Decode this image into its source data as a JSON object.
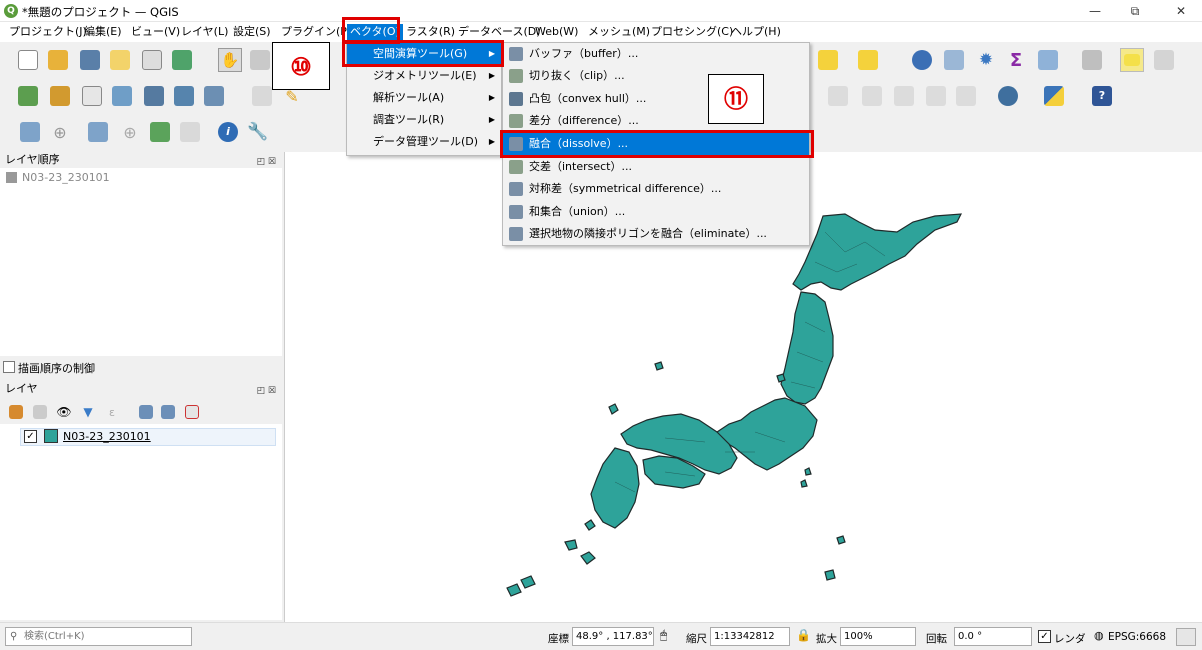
{
  "window": {
    "title": "*無題のプロジェクト — QGIS",
    "minimize": "—",
    "restore": "⧉",
    "close": "✕"
  },
  "menubar": [
    {
      "label": "プロジェクト(J)"
    },
    {
      "label": "編集(E)"
    },
    {
      "label": "ビュー(V)"
    },
    {
      "label": "レイヤ(L)"
    },
    {
      "label": "設定(S)"
    },
    {
      "label": "プラグイン(P)"
    },
    {
      "label": "ベクタ(O)"
    },
    {
      "label": "ラスタ(R)"
    },
    {
      "label": "データベース(D)"
    },
    {
      "label": "Web(W)"
    },
    {
      "label": "メッシュ(M)"
    },
    {
      "label": "プロセシング(C)"
    },
    {
      "label": "ヘルプ(H)"
    }
  ],
  "vector_menu": [
    {
      "label": "空間演算ツール(G)"
    },
    {
      "label": "ジオメトリツール(E)"
    },
    {
      "label": "解析ツール(A)"
    },
    {
      "label": "調査ツール(R)"
    },
    {
      "label": "データ管理ツール(D)"
    }
  ],
  "geoprocessing_menu": [
    {
      "label": "バッファ（buffer）...",
      "icon": "buffer-icon",
      "color": "#7a8fa6"
    },
    {
      "label": "切り抜く（clip）...",
      "icon": "clip-icon",
      "color": "#8aa08a"
    },
    {
      "label": "凸包（convex hull）...",
      "icon": "convex-hull-icon",
      "color": "#5d7790"
    },
    {
      "label": "差分（difference）...",
      "icon": "difference-icon",
      "color": "#8aa08a"
    },
    {
      "label": "融合（dissolve）...",
      "icon": "dissolve-icon",
      "color": "#7a8fa6"
    },
    {
      "label": "交差（intersect）...",
      "icon": "intersect-icon",
      "color": "#8aa08a"
    },
    {
      "label": "対称差（symmetrical difference）...",
      "icon": "sym-difference-icon",
      "color": "#7a8fa6"
    },
    {
      "label": "和集合（union）...",
      "icon": "union-icon",
      "color": "#7a8fa6"
    },
    {
      "label": "選択地物の隣接ポリゴンを融合（eliminate）...",
      "icon": "eliminate-icon",
      "color": "#7a8fa6"
    }
  ],
  "callouts": {
    "step10": "⑩",
    "step11": "⑪"
  },
  "layer_order_panel": {
    "title": "レイヤ順序",
    "item": "N03-23_230101",
    "render_order": "描画順序の制御"
  },
  "layers_panel": {
    "title": "レイヤ",
    "layer_name": "N03-23_230101",
    "layer_color": "#2ea39a"
  },
  "statusbar": {
    "search_placeholder": "検索(Ctrl+K)",
    "coord_label": "座標",
    "coord_value": "48.9° , 117.83°",
    "scale_label": "縮尺",
    "scale_value": "1:13342812",
    "magnify_label": "拡大",
    "magnify_value": "100%",
    "rotation_label": "回転",
    "rotation_value": "0.0 °",
    "render_label": "レンダ",
    "crs": "EPSG:6668"
  },
  "colors": {
    "accent": "#0078d7",
    "highlight_box": "#e00000",
    "map_fill": "#2ea39a"
  }
}
